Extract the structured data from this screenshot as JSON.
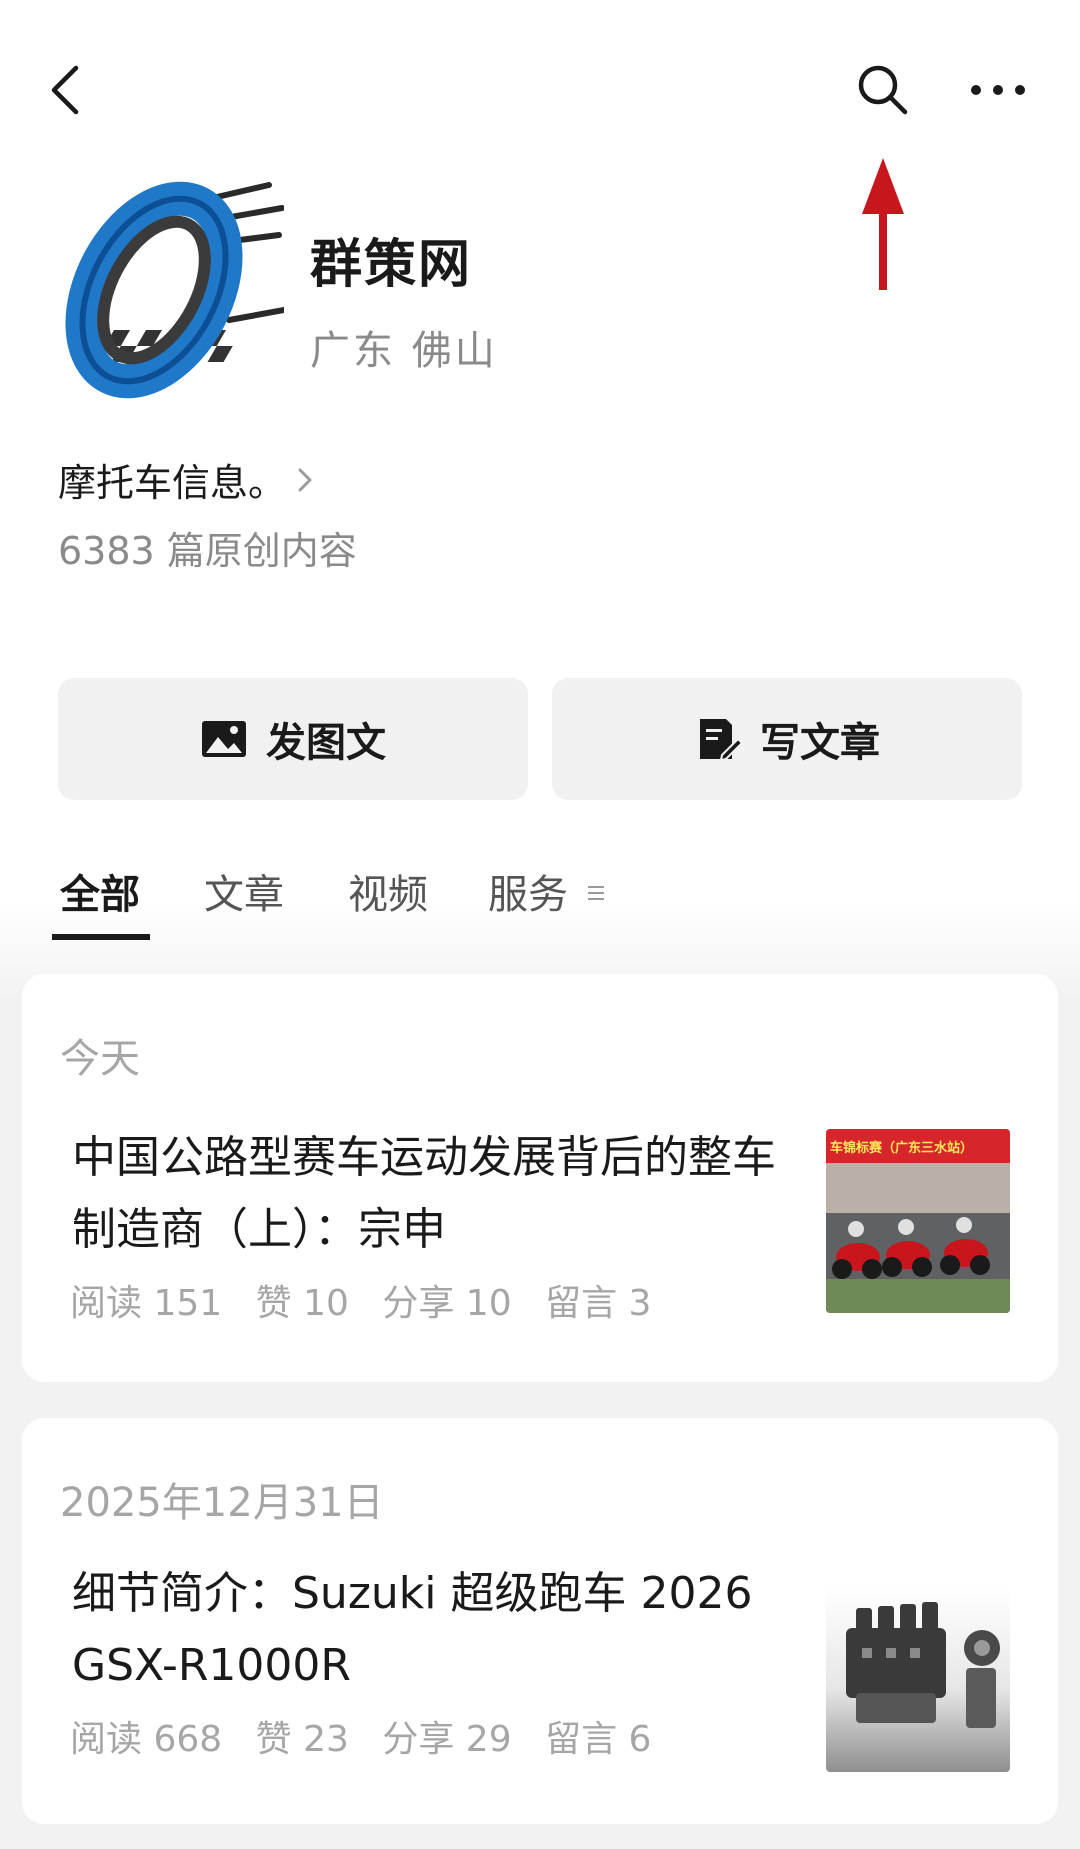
{
  "account": {
    "name": "群策网",
    "location": "广东 佛山",
    "bio": "摩托车信息。",
    "article_count": "6383 篇原创内容"
  },
  "actions": {
    "post_image_label": "发图文",
    "write_article_label": "写文章"
  },
  "tabs": [
    {
      "label": "全部",
      "active": true
    },
    {
      "label": "文章",
      "active": false
    },
    {
      "label": "视频",
      "active": false
    },
    {
      "label": "服务",
      "active": false
    }
  ],
  "articles": [
    {
      "date": "今天",
      "title": "中国公路型赛车运动发展背后的整车制造商（上）：宗申",
      "stats": {
        "read": "阅读 151",
        "like": "赞 10",
        "share": "分享 10",
        "comment": "留言 3"
      },
      "thumb_banner_text": "车锦标赛（广东三水站）"
    },
    {
      "date": "2025年12月31日",
      "title": "细节简介：Suzuki 超级跑车 2026 GSX-R1000R",
      "stats": {
        "read": "阅读 668",
        "like": "赞 23",
        "share": "分享 29",
        "comment": "留言 6"
      }
    }
  ],
  "icons": {
    "back": "back-arrow-icon",
    "search": "search-icon",
    "more": "more-icon",
    "annotation": "red-arrow-annotation",
    "post": "image-icon",
    "write": "edit-document-icon",
    "tab_menu": "menu-lines-icon"
  },
  "colors": {
    "annotation_red": "#c8161d",
    "avatar_blue": "#1f78c8",
    "text_primary": "#1a1a1a",
    "text_secondary": "#8a8a8a"
  }
}
